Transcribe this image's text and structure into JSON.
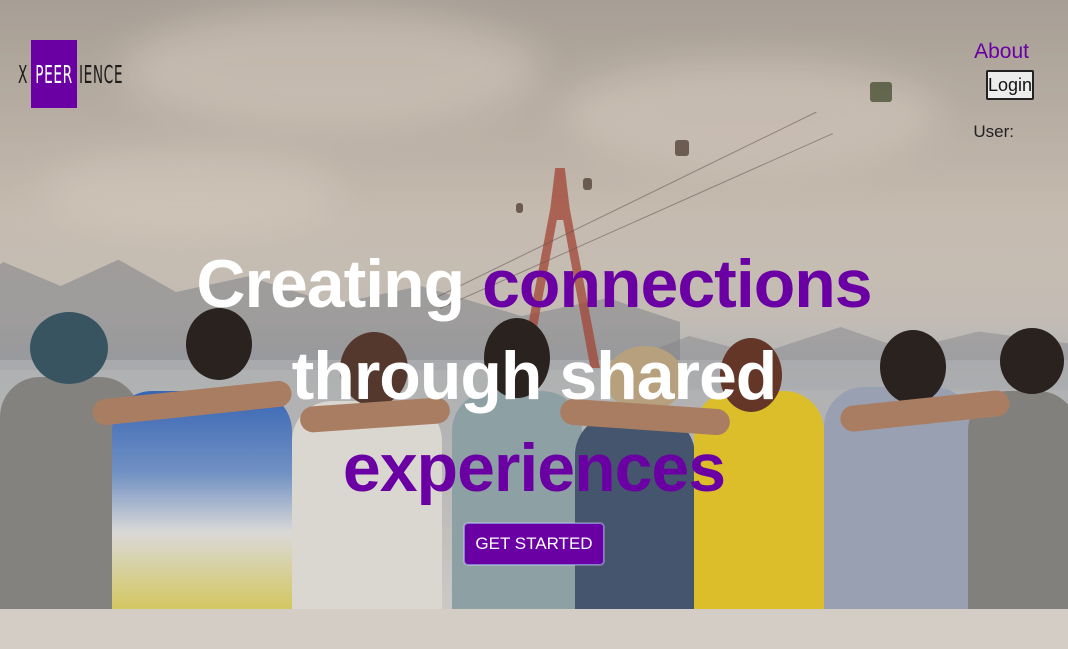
{
  "header": {
    "logo": {
      "x": "X",
      "boxed": "PEER",
      "rest": "IENCE",
      "brand_color": "#6a00a3"
    },
    "nav": {
      "about_label": "About"
    },
    "login_label": "Login",
    "user_label": "User:"
  },
  "hero": {
    "headline": {
      "part1": "Creating",
      "part2": "connections",
      "line2": "through shared",
      "line3": "experiences"
    },
    "cta_label": "GET STARTED",
    "background_image": "group-of-friends-sitting-by-sea-photo"
  },
  "colors": {
    "accent": "#6a00a3",
    "headline_white": "#ffffff"
  }
}
